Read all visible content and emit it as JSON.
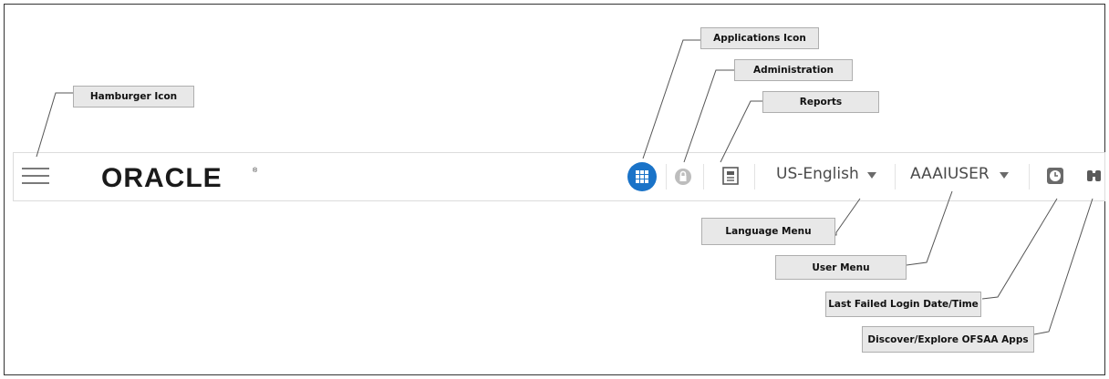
{
  "header": {
    "logo_text": "ORACLE",
    "language": "US-English",
    "user": "AAAIUSER",
    "accent_color": "#1a73c8"
  },
  "callouts": {
    "hamburger": "Hamburger Icon",
    "applications": "Applications Icon",
    "administration": "Administration",
    "reports": "Reports",
    "language_menu": "Language Menu",
    "user_menu": "User Menu",
    "last_failed_login": "Last Failed Login Date/Time",
    "discover": "Discover/Explore OFSAA Apps"
  },
  "icons": {
    "hamburger": "hamburger-icon",
    "applications": "grid-icon",
    "administration": "lock-icon",
    "reports": "report-icon",
    "last_failed_login": "clock-icon",
    "discover": "binoculars-icon"
  }
}
